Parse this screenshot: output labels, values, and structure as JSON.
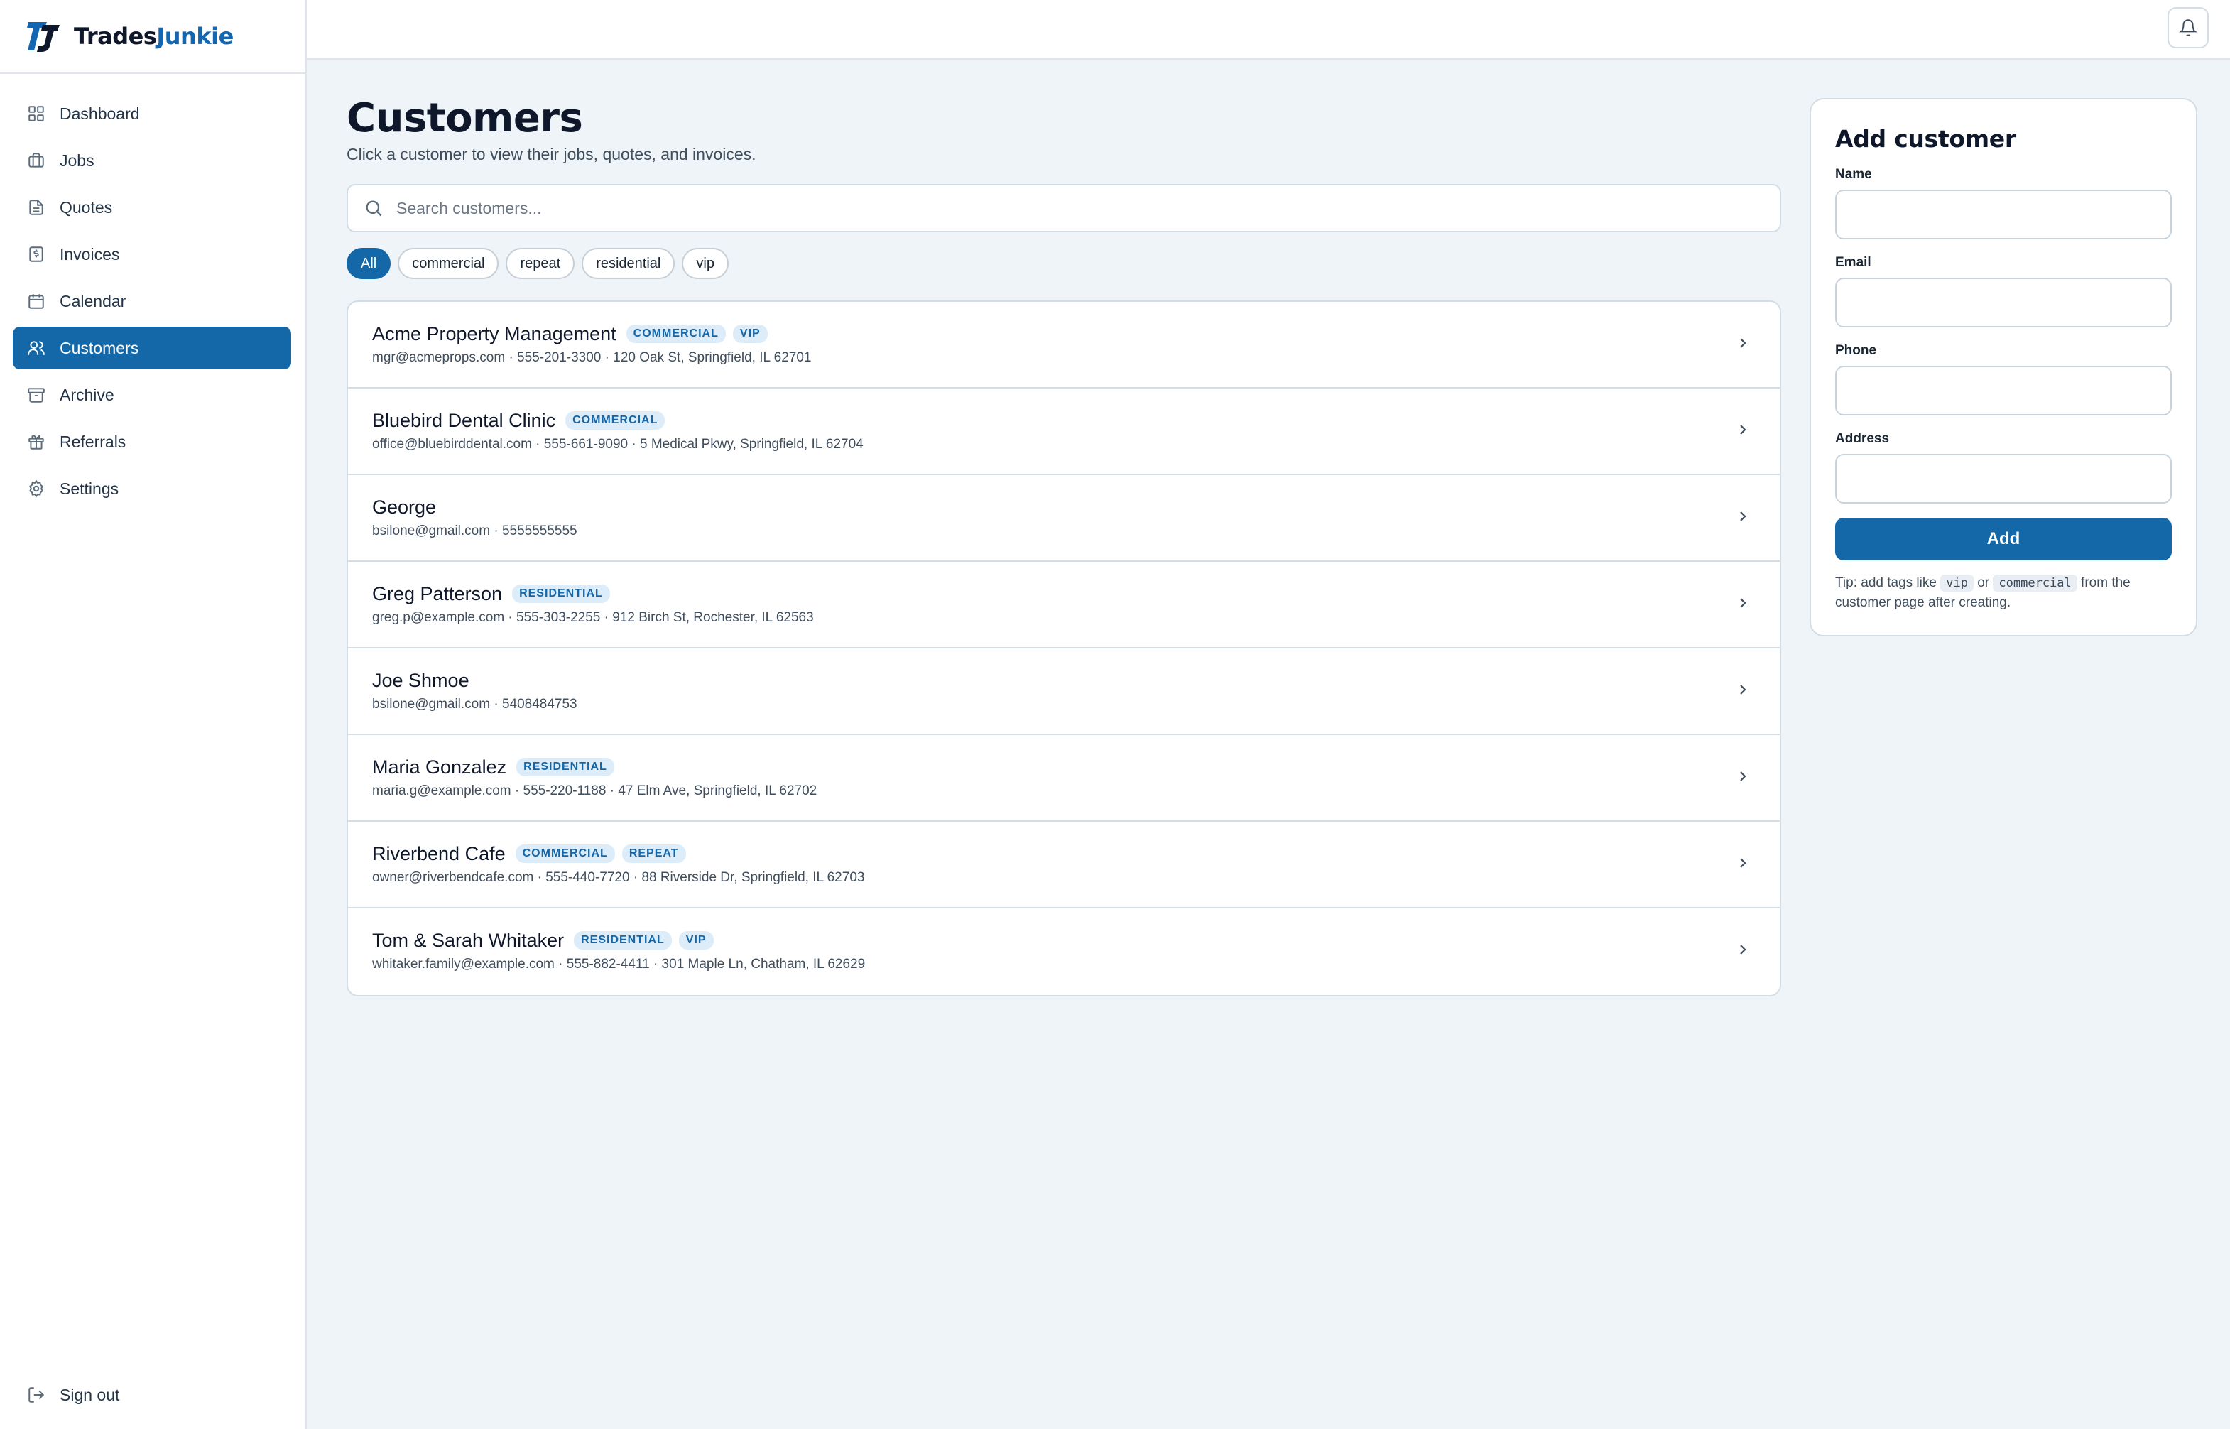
{
  "brand": {
    "part1": "Trades",
    "part2": "Junkie"
  },
  "sidebar": {
    "items": [
      {
        "label": "Dashboard",
        "icon": "grid-icon"
      },
      {
        "label": "Jobs",
        "icon": "briefcase-icon"
      },
      {
        "label": "Quotes",
        "icon": "document-icon"
      },
      {
        "label": "Invoices",
        "icon": "receipt-icon"
      },
      {
        "label": "Calendar",
        "icon": "calendar-icon"
      },
      {
        "label": "Customers",
        "icon": "users-icon",
        "active": true
      },
      {
        "label": "Archive",
        "icon": "archive-icon"
      },
      {
        "label": "Referrals",
        "icon": "gift-icon"
      },
      {
        "label": "Settings",
        "icon": "gear-icon"
      }
    ],
    "signout_label": "Sign out"
  },
  "header": {
    "bell_icon": "bell-icon"
  },
  "main": {
    "title": "Customers",
    "subtitle": "Click a customer to view their jobs, quotes, and invoices.",
    "search_placeholder": "Search customers...",
    "filters": [
      "All",
      "commercial",
      "repeat",
      "residential",
      "vip"
    ],
    "active_filter": "All",
    "customers": [
      {
        "name": "Acme Property Management",
        "tags": [
          "COMMERCIAL",
          "VIP"
        ],
        "meta": "mgr@acmeprops.com · 555-201-3300 · 120 Oak St, Springfield, IL 62701"
      },
      {
        "name": "Bluebird Dental Clinic",
        "tags": [
          "COMMERCIAL"
        ],
        "meta": "office@bluebirddental.com · 555-661-9090 · 5 Medical Pkwy, Springfield, IL 62704"
      },
      {
        "name": "George",
        "tags": [],
        "meta": "bsilone@gmail.com · 5555555555"
      },
      {
        "name": "Greg Patterson",
        "tags": [
          "RESIDENTIAL"
        ],
        "meta": "greg.p@example.com · 555-303-2255 · 912 Birch St, Rochester, IL 62563"
      },
      {
        "name": "Joe Shmoe",
        "tags": [],
        "meta": "bsilone@gmail.com · 5408484753"
      },
      {
        "name": "Maria Gonzalez",
        "tags": [
          "RESIDENTIAL"
        ],
        "meta": "maria.g@example.com · 555-220-1188 · 47 Elm Ave, Springfield, IL 62702"
      },
      {
        "name": "Riverbend Cafe",
        "tags": [
          "COMMERCIAL",
          "REPEAT"
        ],
        "meta": "owner@riverbendcafe.com · 555-440-7720 · 88 Riverside Dr, Springfield, IL 62703"
      },
      {
        "name": "Tom & Sarah Whitaker",
        "tags": [
          "RESIDENTIAL",
          "VIP"
        ],
        "meta": "whitaker.family@example.com · 555-882-4411 · 301 Maple Ln, Chatham, IL 62629"
      }
    ]
  },
  "add_panel": {
    "title": "Add customer",
    "name_label": "Name",
    "email_label": "Email",
    "phone_label": "Phone",
    "address_label": "Address",
    "button_label": "Add",
    "tip_prefix": "Tip: add tags like",
    "tip_tag1": "vip",
    "tip_or": "or",
    "tip_tag2": "commercial",
    "tip_suffix": "from the customer page after creating."
  },
  "colors": {
    "accent": "#1468a8",
    "brand_blue": "#1466b0",
    "tag_bg": "#dcecf8",
    "background": "#eef4f8"
  }
}
